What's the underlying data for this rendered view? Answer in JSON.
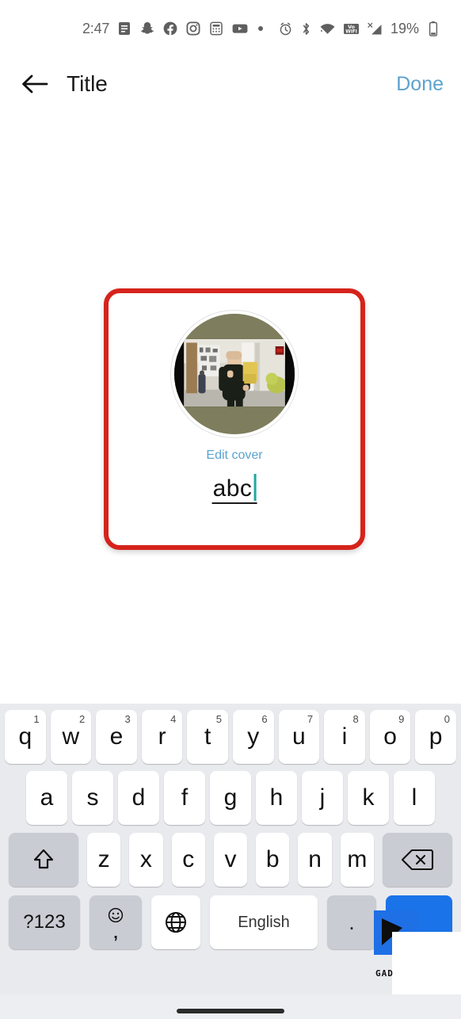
{
  "status_bar": {
    "clock": "2:47",
    "left_icons": [
      {
        "name": "messages-icon",
        "glyph": "messages"
      },
      {
        "name": "snapchat-icon",
        "glyph": "snapchat"
      },
      {
        "name": "facebook-icon",
        "glyph": "facebook"
      },
      {
        "name": "instagram-icon",
        "glyph": "instagram"
      },
      {
        "name": "calculator-icon",
        "glyph": "calculator"
      },
      {
        "name": "youtube-icon",
        "glyph": "youtube"
      },
      {
        "name": "more-notifications-dot-icon",
        "glyph": "dot"
      }
    ],
    "right_icons": [
      {
        "name": "alarm-icon",
        "glyph": "alarm"
      },
      {
        "name": "bluetooth-icon",
        "glyph": "bluetooth"
      },
      {
        "name": "wifi-icon",
        "glyph": "wifi"
      },
      {
        "name": "vowifi-icon",
        "glyph": "vowifi",
        "label_top": "Vo",
        "label_bottom": "WiFi"
      },
      {
        "name": "cellular-signal-no-service-icon",
        "glyph": "signal-x"
      }
    ],
    "battery_percent": "19%"
  },
  "app_bar": {
    "back_label": "back",
    "title": "Title",
    "done_label": "Done"
  },
  "card": {
    "edit_cover_label": "Edit cover",
    "name_value": "abc",
    "highlight_color": "#d5231b",
    "accent_color": "#5ba3d0",
    "caret_color": "#1fa8a0"
  },
  "keyboard": {
    "language_label": "English",
    "symbols_label": "?123",
    "comma_label": ",",
    "period_label": ".",
    "row1": [
      {
        "letter": "q",
        "num": "1"
      },
      {
        "letter": "w",
        "num": "2"
      },
      {
        "letter": "e",
        "num": "3"
      },
      {
        "letter": "r",
        "num": "4"
      },
      {
        "letter": "t",
        "num": "5"
      },
      {
        "letter": "y",
        "num": "6"
      },
      {
        "letter": "u",
        "num": "7"
      },
      {
        "letter": "i",
        "num": "8"
      },
      {
        "letter": "o",
        "num": "9"
      },
      {
        "letter": "p",
        "num": "0"
      }
    ],
    "row2": [
      {
        "letter": "a"
      },
      {
        "letter": "s"
      },
      {
        "letter": "d"
      },
      {
        "letter": "f"
      },
      {
        "letter": "g"
      },
      {
        "letter": "h"
      },
      {
        "letter": "j"
      },
      {
        "letter": "k"
      },
      {
        "letter": "l"
      }
    ],
    "row3": [
      {
        "letter": "z"
      },
      {
        "letter": "x"
      },
      {
        "letter": "c"
      },
      {
        "letter": "v"
      },
      {
        "letter": "b"
      },
      {
        "letter": "n"
      },
      {
        "letter": "m"
      }
    ]
  },
  "watermark": {
    "text": "GAD"
  }
}
